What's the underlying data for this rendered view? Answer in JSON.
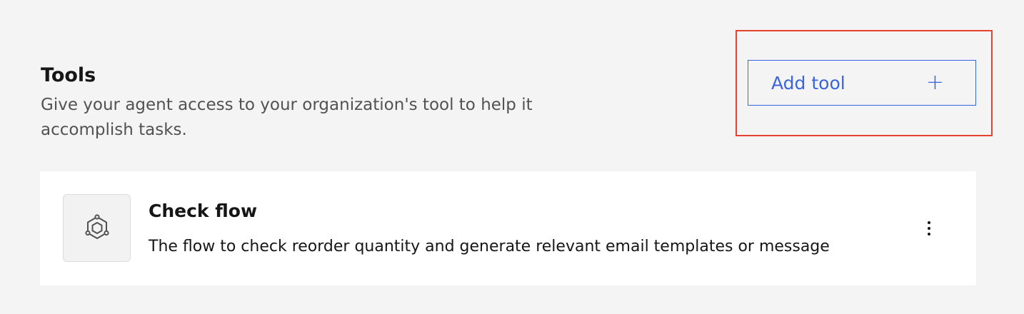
{
  "tools_section": {
    "title": "Tools",
    "description": "Give your agent access to your organization's tool to help it accomplish tasks.",
    "add_button": {
      "label": "Add tool",
      "icon": "plus-icon"
    }
  },
  "tools": [
    {
      "name": "Check flow",
      "description": "The flow to check reorder quantity and generate relevant email templates or message",
      "icon": "flow-icon",
      "menu_icon": "overflow-menu-vertical-icon"
    }
  ],
  "colors": {
    "background": "#f4f4f4",
    "card": "#ffffff",
    "accent": "#3a64e0",
    "highlight": "#e5412d",
    "text_primary": "#161616",
    "text_secondary": "#525252"
  }
}
